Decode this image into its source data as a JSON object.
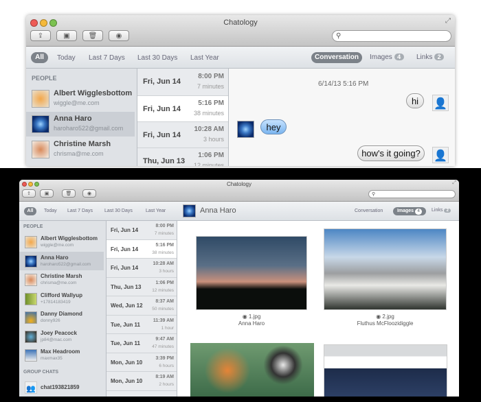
{
  "app_title": "Chatology",
  "toolbar": {
    "buttons": [
      "share-icon",
      "contacts-icon",
      "trash-icon",
      "eye-icon"
    ],
    "search_placeholder": ""
  },
  "filters": [
    "All",
    "Today",
    "Last 7 Days",
    "Last 30 Days",
    "Last Year"
  ],
  "view_tabs": {
    "conversation": "Conversation",
    "images": "Images",
    "images_count": "4",
    "links": "Links",
    "links_count": "2"
  },
  "sidebar": {
    "people_header": "PEOPLE",
    "people": [
      {
        "name": "Albert Wigglesbottom",
        "detail": "wiggle@me.com"
      },
      {
        "name": "Anna Haro",
        "detail": "haroharo522@gmail.com"
      },
      {
        "name": "Christine Marsh",
        "detail": "chrisma@me.com"
      },
      {
        "name": "Clifford Wallyup",
        "detail": "+17814183419"
      },
      {
        "name": "Danny Diamond",
        "detail": "donny926"
      },
      {
        "name": "Joey Peacock",
        "detail": "jp84@mac.com"
      },
      {
        "name": "Max Headroom",
        "detail": "maxmax35"
      }
    ],
    "group_header": "GROUP CHATS",
    "groups": [
      {
        "name": "chat193821859"
      }
    ]
  },
  "conversations": [
    {
      "date": "Fri, Jun 14",
      "time": "8:00 PM",
      "duration": "7 minutes"
    },
    {
      "date": "Fri, Jun 14",
      "time": "5:16 PM",
      "duration": "38 minutes"
    },
    {
      "date": "Fri, Jun 14",
      "time": "10:28 AM",
      "duration": "3 hours"
    },
    {
      "date": "Thu, Jun 13",
      "time": "1:06 PM",
      "duration": "12 minutes"
    },
    {
      "date": "Wed, Jun 12",
      "time": "8:37 AM",
      "duration": "50 minutes"
    },
    {
      "date": "Tue, Jun 11",
      "time": "11:39 AM",
      "duration": "1 hour"
    },
    {
      "date": "Tue, Jun 11",
      "time": "9:47 AM",
      "duration": "47 minutes"
    },
    {
      "date": "Mon, Jun 10",
      "time": "3:39 PM",
      "duration": "6 hours"
    },
    {
      "date": "Mon, Jun 10",
      "time": "8:19 AM",
      "duration": "2 hours"
    }
  ],
  "chat": {
    "timestamp": "6/14/13 5:16 PM",
    "messages": [
      {
        "from": "me",
        "text": "hi"
      },
      {
        "from": "Anna Haro",
        "text": "hey"
      },
      {
        "from": "me",
        "text": "how's it going?"
      }
    ]
  },
  "images_view": {
    "contact": "Anna Haro",
    "images": [
      {
        "file": "1.jpg",
        "sender": "Anna Haro"
      },
      {
        "file": "2.jpg",
        "sender": "Fluthus McFloozidiggle"
      }
    ]
  }
}
